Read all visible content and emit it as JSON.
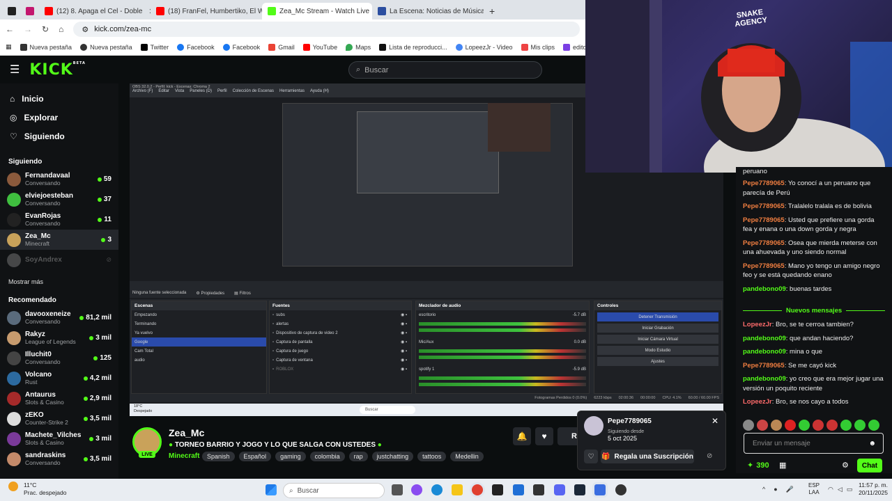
{
  "browser": {
    "tabs": [
      {
        "label": "",
        "color": "#222"
      },
      {
        "label": "",
        "color": "#c3166e"
      },
      {
        "label": "(12) 8. Apaga el Cel - Doble",
        "color": "#ff0000"
      },
      {
        "label": "(18) FranFel, Humbertiko, El WE",
        "color": "#ff0000"
      },
      {
        "label": "Zea_Mc Stream - Watch Live",
        "color": "#53fc18"
      },
      {
        "label": "La Escena: Noticias de Música y",
        "color": "#2b4ea0"
      }
    ],
    "url": "kick.com/zea-mc",
    "bookmarks": [
      "Nueva pestaña",
      "Nueva pestaña",
      "Twitter",
      "Facebook",
      "Facebook",
      "Gmail",
      "YouTube",
      "Maps",
      "Lista de reproducci...",
      "LopeezJr - Video",
      "Mis clips",
      "editor de videos onl"
    ]
  },
  "kick": {
    "logo": "KICK",
    "logo_beta": "BETA",
    "search_placeholder": "Buscar",
    "nav": [
      {
        "label": "Inicio",
        "icon": "home-icon"
      },
      {
        "label": "Explorar",
        "icon": "compass-icon"
      },
      {
        "label": "Siguiendo",
        "icon": "heart-icon"
      }
    ],
    "following_title": "Siguiendo",
    "following": [
      {
        "name": "Fernandavaal",
        "category": "Conversando",
        "viewers": "59",
        "color": "#8b5a3c"
      },
      {
        "name": "elviejoesteban",
        "category": "Conversando",
        "viewers": "37",
        "color": "#3fbf3f"
      },
      {
        "name": "EvanRojas",
        "category": "Conversando",
        "viewers": "11",
        "color": "#222"
      },
      {
        "name": "Zea_Mc",
        "category": "Minecraft",
        "viewers": "3",
        "color": "#c9a25a"
      }
    ],
    "offline": {
      "name": "SoyAndrex"
    },
    "show_more": "Mostrar más",
    "recommended_title": "Recomendado",
    "recommended": [
      {
        "name": "davooxeneize",
        "category": "Conversando",
        "viewers": "81,2 mil",
        "color": "#5a6b7c"
      },
      {
        "name": "Rakyz",
        "category": "League of Legends",
        "viewers": "3 mil",
        "color": "#c79b6e"
      },
      {
        "name": "Illuchit0",
        "category": "Conversando",
        "viewers": "125",
        "color": "#444"
      },
      {
        "name": "Volcano",
        "category": "Rust",
        "viewers": "4,2 mil",
        "color": "#2c6aa0"
      },
      {
        "name": "Antaurus",
        "category": "Slots & Casino",
        "viewers": "2,9 mil",
        "color": "#a52a2a"
      },
      {
        "name": "zEKO",
        "category": "Counter-Strike 2",
        "viewers": "3,5 mil",
        "color": "#ddd"
      },
      {
        "name": "Machete_Vilches",
        "category": "Slots & Casino",
        "viewers": "3 mil",
        "color": "#7a3a9a"
      },
      {
        "name": "sandraskins",
        "category": "Conversando",
        "viewers": "3,5 mil",
        "color": "#c48a6a"
      }
    ]
  },
  "obs": {
    "menu_title": "OBS 32.0.2 - Perfil: kick - Escenas: Chroma 2",
    "menu": [
      "Archivo (F)",
      "Editar",
      "Vista",
      "Paneles (D)",
      "Perfil",
      "Colección de Escenas",
      "Herramientas",
      "Ayuda (H)"
    ],
    "no_source": "Ninguna fuente seleccionada",
    "props": "Propiedades",
    "filters": "Filtros",
    "scenes_title": "Escenas",
    "scenes": [
      "Empezando",
      "Terminando",
      "Ya vuelvo",
      "Google",
      "Cam Total",
      "audio"
    ],
    "sources_title": "Fuentes",
    "sources": [
      "subs",
      "alertas",
      "Dispositivo de captura de video 2",
      "Captura de pantalla",
      "Captura de juego",
      "Captura de ventana",
      "ROBLOX"
    ],
    "mixer_title": "Mezclador de audio",
    "mixer": [
      {
        "name": "escritorio",
        "db": "-5.7 dB"
      },
      {
        "name": "Mic/Aux",
        "db": "0.0 dB"
      },
      {
        "name": "spotify 1",
        "db": "-5.9 dB"
      }
    ],
    "controls_title": "Controles",
    "controls": [
      "Detener Transmisión",
      "Iniciar Grabación",
      "Iniciar Cámara Virtual",
      "Modo Estudio",
      "Ajustes"
    ],
    "status": [
      "Fotogramas Perdidos 0 (0.0%)",
      "6223 kbps",
      "02:00:36",
      "00:00:00",
      "CPU: 4.1%",
      "60.00 / 60.00 FPS"
    ],
    "inner_taskbar_search": "Buscar",
    "weather": "18°C",
    "weather_sub": "Despejado"
  },
  "stream": {
    "name": "Zea_Mc",
    "live": "LIVE",
    "title": "TORNEO BARRIO Y JOGO  Y LO QUE SALGA  CON USTEDES",
    "category": "Minecraft",
    "tags": [
      "Spanish",
      "Español",
      "gaming",
      "colombia",
      "rap",
      "justchatting",
      "tattoos",
      "Medellin"
    ],
    "partial_btn": "R"
  },
  "popover": {
    "user": "Pepe7789065",
    "since_label": "Siguiendo desde",
    "since_date": "5 oct 2025",
    "gift_button": "Regala una Suscripción"
  },
  "chat": {
    "top_fragment": "peruano",
    "messages": [
      {
        "user": "Pepe7789065",
        "color": "#f07e40",
        "text": "Yo conocí a un peruano que parecía de Perú"
      },
      {
        "user": "Pepe7789065",
        "color": "#f07e40",
        "text": "Tralalelo tralala es de bolivia"
      },
      {
        "user": "Pepe7789065",
        "color": "#f07e40",
        "text": "Usted que prefiere una gorda fea y enana o una down gorda y negra"
      },
      {
        "user": "Pepe7789065",
        "color": "#f07e40",
        "text": "Osea que mierda meterse con una ahuevada y uno siendo normal"
      },
      {
        "user": "Pepe7789065",
        "color": "#f07e40",
        "text": "Mano yo tengo un amigo negro feo y se está quedando enano"
      },
      {
        "user": "pandebono09",
        "color": "#53fc18",
        "text": "buenas tardes"
      }
    ],
    "new_messages": "Nuevos mensajes",
    "messages_new": [
      {
        "user": "LopeezJr",
        "color": "#ff6b6b",
        "text": "Bro, se te cerroa tambien?"
      },
      {
        "user": "pandebono09",
        "color": "#53fc18",
        "text": "que andan haciendo?"
      },
      {
        "user": "pandebono09",
        "color": "#53fc18",
        "text": "mina o que"
      },
      {
        "user": "Pepe7789065",
        "color": "#f07e40",
        "text": "Se me cayó kick"
      },
      {
        "user": "pandebono09",
        "color": "#53fc18",
        "text": "yo creo que era mejor jugar una versión un poquito reciente"
      },
      {
        "user": "LopeezJr",
        "color": "#ff6b6b",
        "text": "Bro, se nos cayo a todos"
      }
    ],
    "input_placeholder": "Enviar un mensaje",
    "points": "390",
    "chat_button": "Chat"
  },
  "webcam": {
    "logo_line1": "SNAKE",
    "logo_line2": "AGENCY"
  },
  "taskbar": {
    "weather_temp": "11°C",
    "weather_desc": "Prac. despejado",
    "search": "Buscar",
    "lang": "ESP",
    "lang_sub": "LAA",
    "time": "11:57 p. m.",
    "date": "20/11/2025"
  }
}
